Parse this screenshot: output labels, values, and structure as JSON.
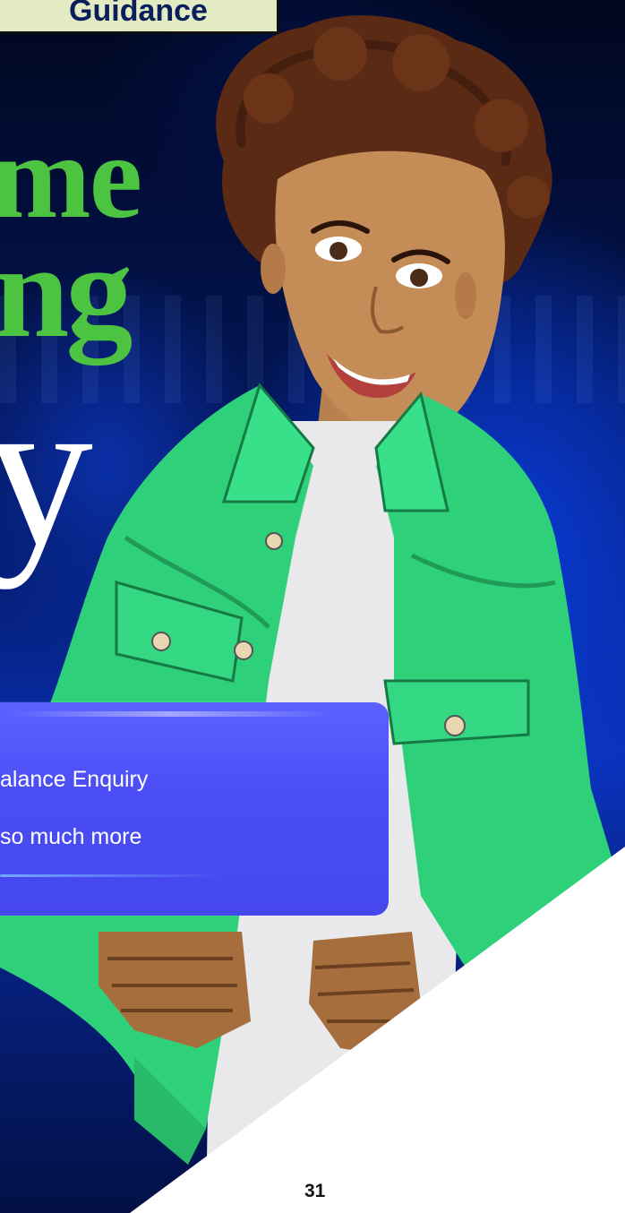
{
  "badge": {
    "label": "Guidance"
  },
  "headline": {
    "line1": "me",
    "line2": "ng",
    "line3": "y"
  },
  "card": {
    "items": [
      "alance Enquiry",
      "so much more"
    ]
  },
  "footer": {
    "page_number": "31"
  },
  "colors": {
    "background": "#031a66",
    "headline_green": "#4cc441",
    "card_blue": "#4a4cf5",
    "jacket_green": "#2fd07a",
    "badge_bg": "#e3ebc3"
  },
  "icons": [
    "character-illustration"
  ]
}
